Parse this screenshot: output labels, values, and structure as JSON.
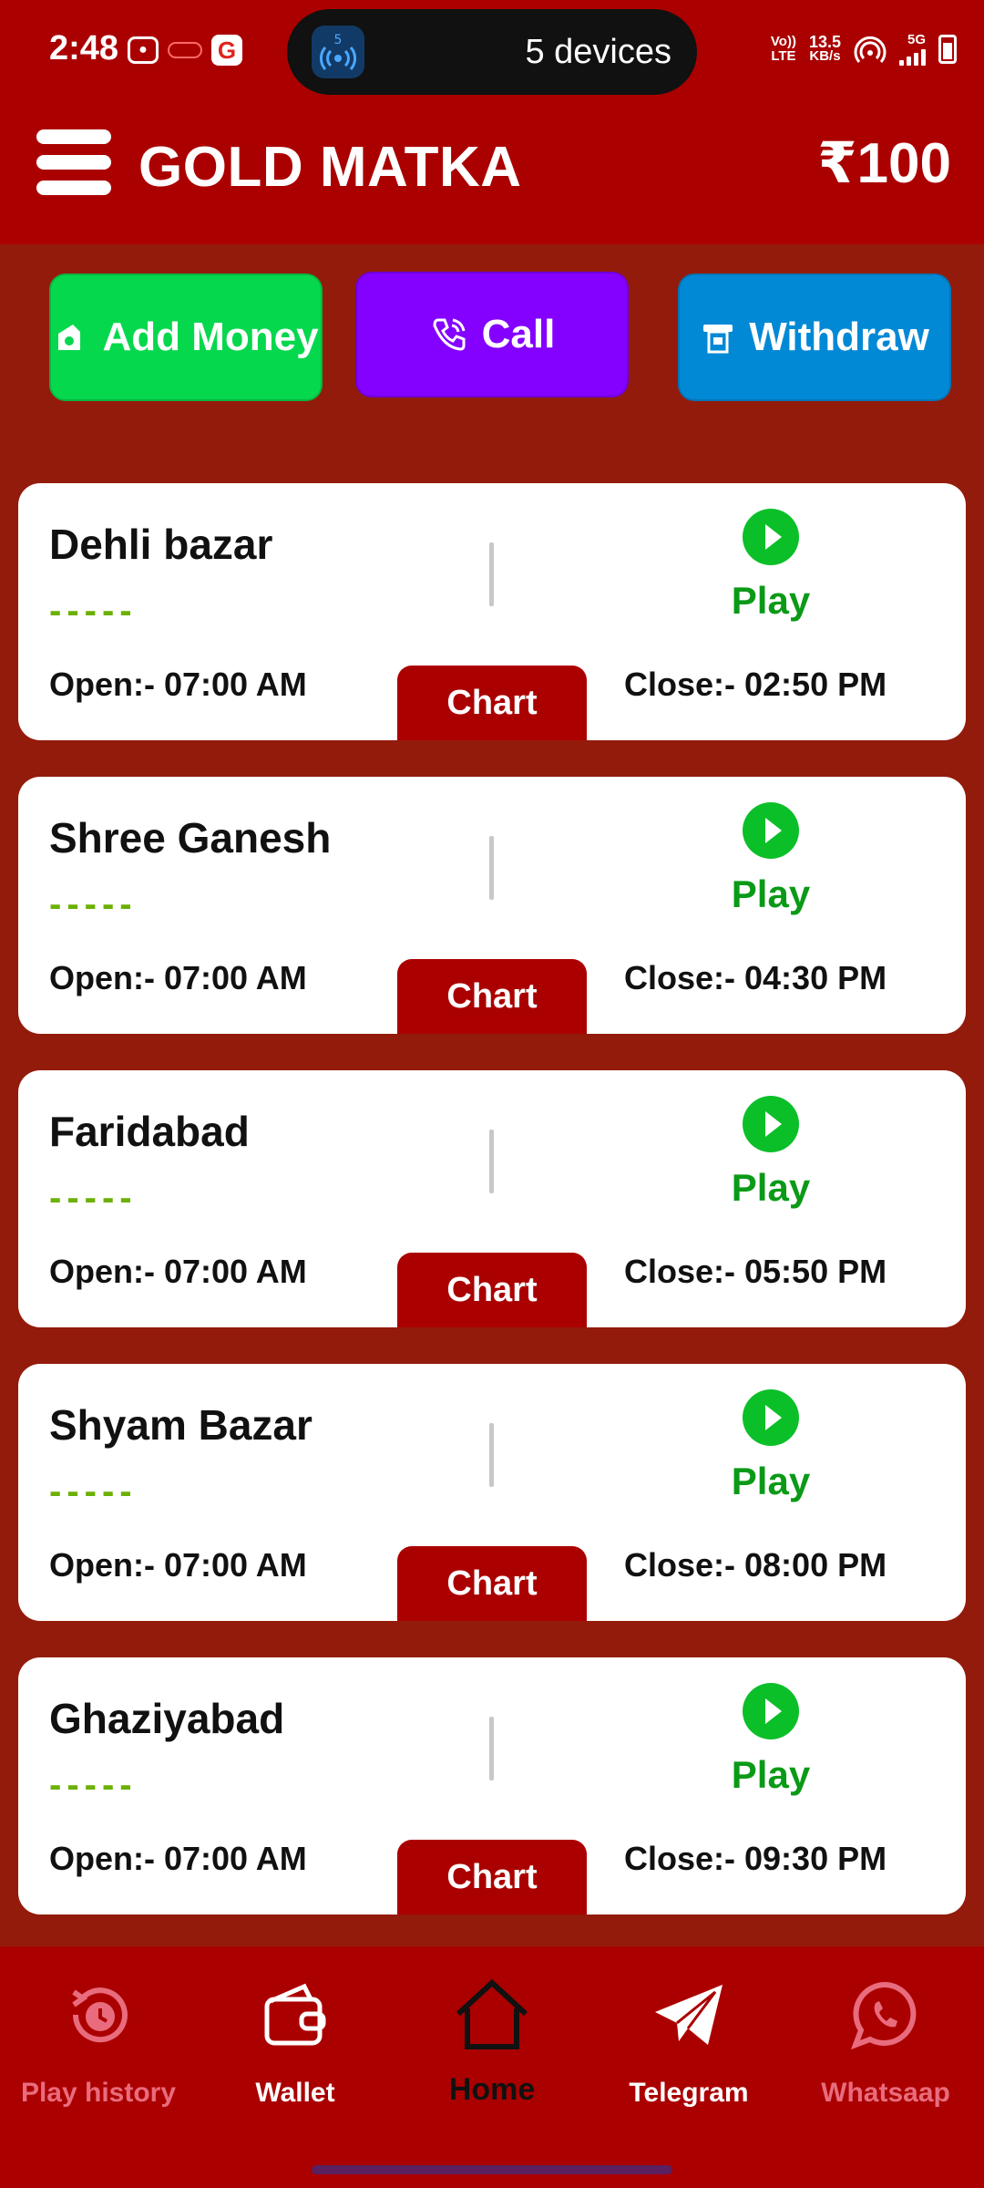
{
  "status_bar": {
    "time": "2:48",
    "pill_badge": "5",
    "pill_text": "5 devices",
    "net_type_top": "Vo))",
    "net_type_bottom": "LTE",
    "speed_value": "13.5",
    "speed_unit": "KB/s",
    "signal_label": "5G"
  },
  "app_bar": {
    "title": "GOLD MATKA",
    "balance": "₹100"
  },
  "actions": {
    "add_money": "Add Money",
    "call": "Call",
    "withdraw": "Withdraw"
  },
  "markets": [
    {
      "name": "Dehli bazar",
      "result": "-----",
      "play": "Play",
      "open": "Open:- 07:00 AM",
      "chart": "Chart",
      "close": "Close:- 02:50 PM"
    },
    {
      "name": "Shree Ganesh",
      "result": "-----",
      "play": "Play",
      "open": "Open:- 07:00 AM",
      "chart": "Chart",
      "close": "Close:- 04:30 PM"
    },
    {
      "name": "Faridabad",
      "result": "-----",
      "play": "Play",
      "open": "Open:- 07:00 AM",
      "chart": "Chart",
      "close": "Close:- 05:50 PM"
    },
    {
      "name": "Shyam Bazar",
      "result": "-----",
      "play": "Play",
      "open": "Open:- 07:00 AM",
      "chart": "Chart",
      "close": "Close:- 08:00 PM"
    },
    {
      "name": "Ghaziyabad",
      "result": "-----",
      "play": "Play",
      "open": "Open:- 07:00 AM",
      "chart": "Chart",
      "close": "Close:- 09:30 PM"
    }
  ],
  "bottom_nav": {
    "play_history": "Play history",
    "wallet": "Wallet",
    "home": "Home",
    "telegram": "Telegram",
    "whatsapp": "Whatsaap"
  },
  "colors": {
    "header": "#ab0000",
    "background": "#931b0b",
    "add_money": "#06d84d",
    "call": "#8400ff",
    "withdraw": "#0289d6",
    "play": "#0bbf28"
  }
}
